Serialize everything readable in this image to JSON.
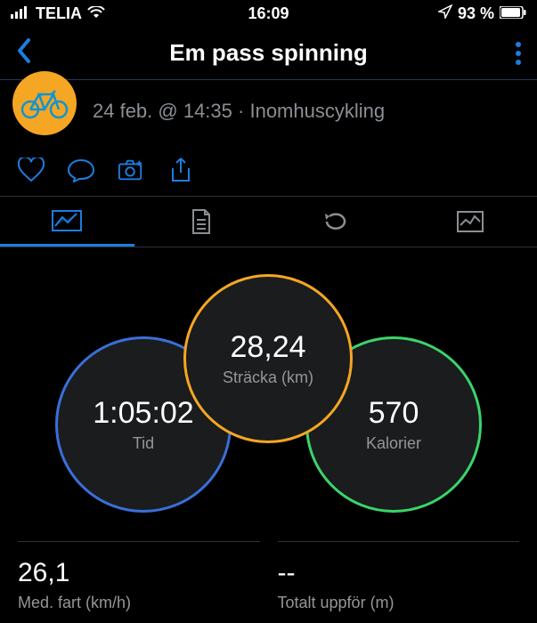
{
  "status": {
    "carrier": "TELIA",
    "time": "16:09",
    "battery": "93 %"
  },
  "nav": {
    "title": "Em pass spinning"
  },
  "meta": {
    "date": "24 feb. @ 14:35",
    "separator": "·",
    "activity": "Inomhuscykling"
  },
  "circles": {
    "time": {
      "value": "1:05:02",
      "label": "Tid"
    },
    "distance": {
      "value": "28,24",
      "label": "Sträcka (km)"
    },
    "calories": {
      "value": "570",
      "label": "Kalorier"
    }
  },
  "stats": {
    "avg_speed": {
      "value": "26,1",
      "label": "Med. fart (km/h)"
    },
    "total_ascent": {
      "value": "--",
      "label": "Totalt uppför (m)"
    }
  }
}
